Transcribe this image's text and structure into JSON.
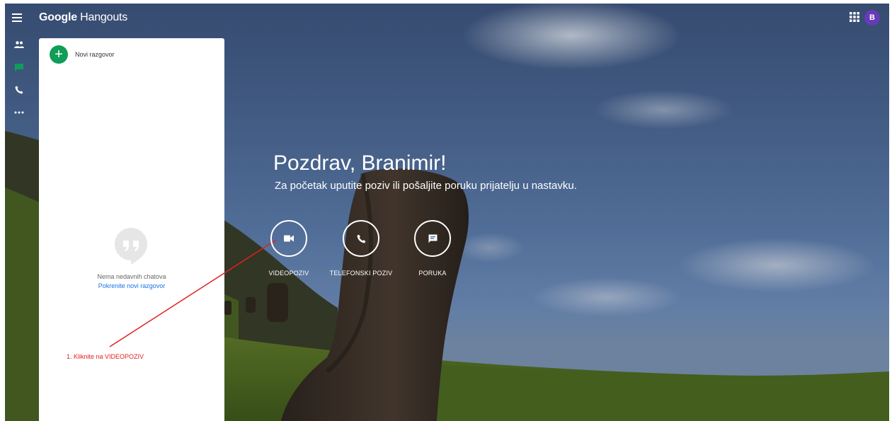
{
  "app": {
    "brand_prefix": "Google",
    "brand_name": "Hangouts",
    "avatar_initial": "B"
  },
  "left_panel": {
    "new_chat_label": "Novi razgovor",
    "empty_state": "Nema nedavnih chatova",
    "start_link": "Pokrenite novi razgovor"
  },
  "main": {
    "greeting": "Pozdrav, Branimir!",
    "subtitle": "Za početak uputite poziv ili pošaljite poruku prijatelju u nastavku.",
    "actions": [
      {
        "label": "VIDEOPOZIV",
        "icon": "videocam-icon"
      },
      {
        "label": "TELEFONSKI POZIV",
        "icon": "phone-icon"
      },
      {
        "label": "PORUKA",
        "icon": "message-icon"
      }
    ]
  },
  "annotation": {
    "text": "1. Kliknite na VIDEOPOZIV",
    "color": "#e02020"
  },
  "colors": {
    "accent_green": "#0f9d58",
    "avatar_purple": "#673ab7",
    "link_blue": "#1a73e8"
  }
}
